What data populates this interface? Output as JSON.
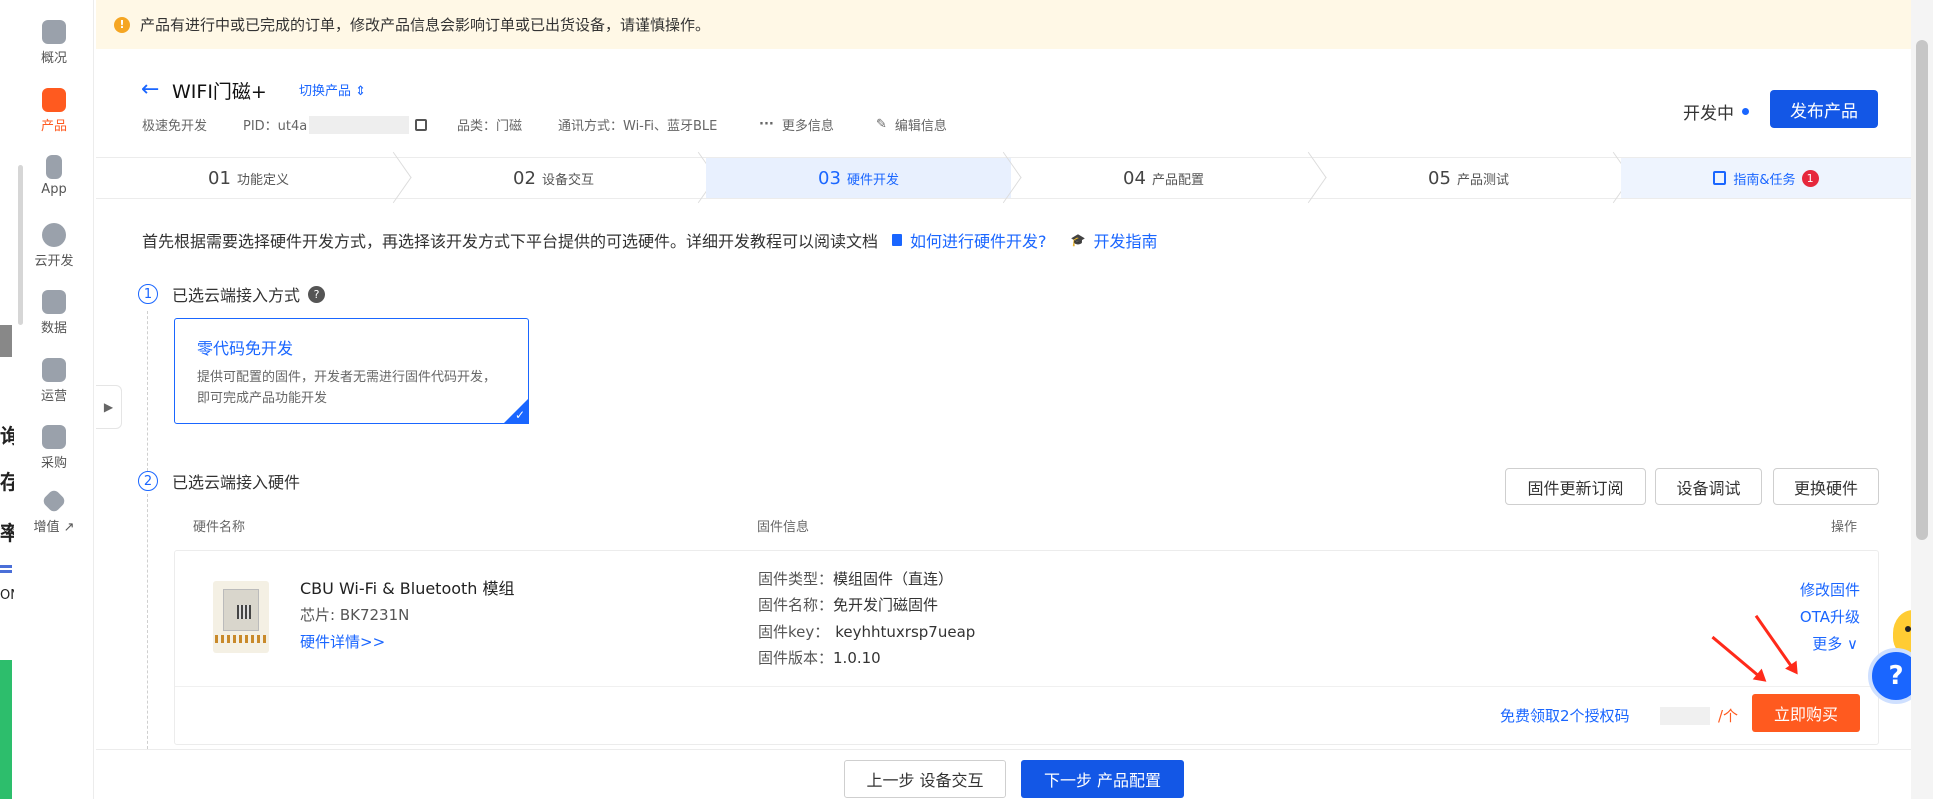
{
  "left_fragments": [
    "询",
    "存",
    "率",
    "ON"
  ],
  "sidebar": {
    "items": [
      {
        "label": "概况",
        "icon": "home-icon"
      },
      {
        "label": "产品",
        "icon": "product-icon"
      },
      {
        "label": "App",
        "icon": "phone-icon"
      },
      {
        "label": "云开发",
        "icon": "cloud-icon"
      },
      {
        "label": "数据",
        "icon": "chart-icon"
      },
      {
        "label": "运营",
        "icon": "star-icon"
      },
      {
        "label": "采购",
        "icon": "box-icon"
      },
      {
        "label": "增值 ↗",
        "icon": "diamond-icon"
      }
    ]
  },
  "notice": {
    "text": "产品有进行中或已完成的订单，修改产品信息会影响订单或已出货设备，请谨慎操作。"
  },
  "product": {
    "name": "WIFI门磁+",
    "switch_label": "切换产品",
    "mode": "极速免开发",
    "pid_label": "PID：ut4a",
    "category": "品类：门磁",
    "comm": "通讯方式：Wi-Fi、蓝牙BLE",
    "more_info": "更多信息",
    "edit_info": "编辑信息",
    "status": "开发中",
    "publish_label": "发布产品"
  },
  "steps": [
    {
      "num": "01",
      "label": "功能定义"
    },
    {
      "num": "02",
      "label": "设备交互"
    },
    {
      "num": "03",
      "label": "硬件开发"
    },
    {
      "num": "04",
      "label": "产品配置"
    },
    {
      "num": "05",
      "label": "产品测试"
    }
  ],
  "guide_tab": {
    "label": "指南&任务",
    "badge": "1"
  },
  "intro": {
    "text": "首先根据需要选择硬件开发方式，再选择该开发方式下平台提供的可选硬件。详细开发教程可以阅读文档",
    "link1": "如何进行硬件开发?",
    "link2": "开发指南"
  },
  "section1": {
    "num": "1",
    "title": "已选云端接入方式"
  },
  "card": {
    "title": "零代码免开发",
    "desc": "提供可配置的固件，开发者无需进行固件代码开发，即可完成产品功能开发"
  },
  "section2": {
    "num": "2",
    "title": "已选云端接入硬件"
  },
  "actions": {
    "subscribe": "固件更新订阅",
    "debug": "设备调试",
    "replace": "更换硬件"
  },
  "table": {
    "col_name": "硬件名称",
    "col_fw": "固件信息",
    "col_op": "操作"
  },
  "hardware": {
    "name": "CBU Wi-Fi & Bluetooth 模组",
    "chip": "芯片: BK7231N",
    "details_link": "硬件详情>>",
    "fw_type_label": "固件类型：",
    "fw_type": "模组固件（直连）",
    "fw_name_label": "固件名称：",
    "fw_name": "免开发门磁固件",
    "fw_key_label": "固件key：",
    "fw_key": "keyhhtuxrsp7ueap",
    "fw_ver_label": "固件版本：",
    "fw_ver": "1.0.10",
    "op_modify": "修改固件",
    "op_ota": "OTA升级",
    "op_more": "更多 ∨",
    "free_codes": "免费领取2个授权码",
    "price_unit": "/个",
    "buy_label": "立即购买"
  },
  "footer": {
    "prev": "上一步 设备交互",
    "next": "下一步 产品配置"
  },
  "colors": {
    "primary": "#1357e6",
    "accent": "#ff5a1f",
    "notice_bg": "#fff8e6"
  }
}
